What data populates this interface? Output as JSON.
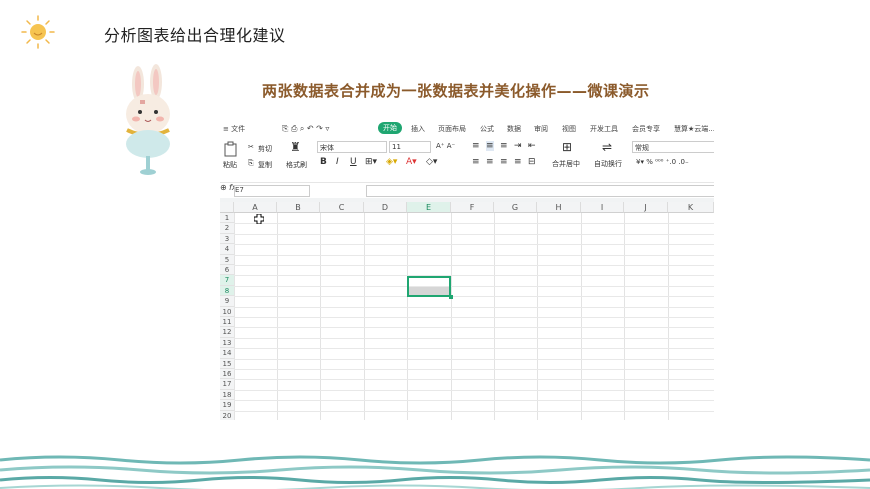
{
  "slide": {
    "title": "分析图表给出合理化建议",
    "video_title": "两张数据表合并成为一张数据表并美化操作——微课演示"
  },
  "colors": {
    "accent": "#1fa671",
    "title_brown": "#8b5a2b",
    "wave_teal": "#6fb8b5"
  },
  "menu": {
    "file": "≡ 文件",
    "tabs": [
      "开始",
      "插入",
      "页面布局",
      "公式",
      "数据",
      "审阅",
      "视图",
      "开发工具",
      "会员专享",
      "慧算★云端..."
    ]
  },
  "ribbon": {
    "paste": "粘贴",
    "cut": "剪切",
    "copy": "复制",
    "format_painter": "格式刷",
    "font_name": "宋体",
    "font_size": "11",
    "merge_center": "合并居中",
    "wrap_text": "自动换行",
    "number_format": "常规",
    "bold": "B",
    "italic": "I",
    "underline": "U"
  },
  "formula_bar": {
    "cell_ref": "E7",
    "fx": "fx",
    "value": ""
  },
  "sheet": {
    "columns": [
      "A",
      "B",
      "C",
      "D",
      "E",
      "F",
      "G",
      "H",
      "I",
      "J",
      "K"
    ],
    "rows": [
      "1",
      "2",
      "3",
      "4",
      "5",
      "6",
      "7",
      "8",
      "9",
      "10",
      "11",
      "12",
      "13",
      "14",
      "15",
      "16",
      "17",
      "18",
      "19",
      "20"
    ],
    "selected_column": "E",
    "selected_rows": [
      "7",
      "8"
    ]
  }
}
